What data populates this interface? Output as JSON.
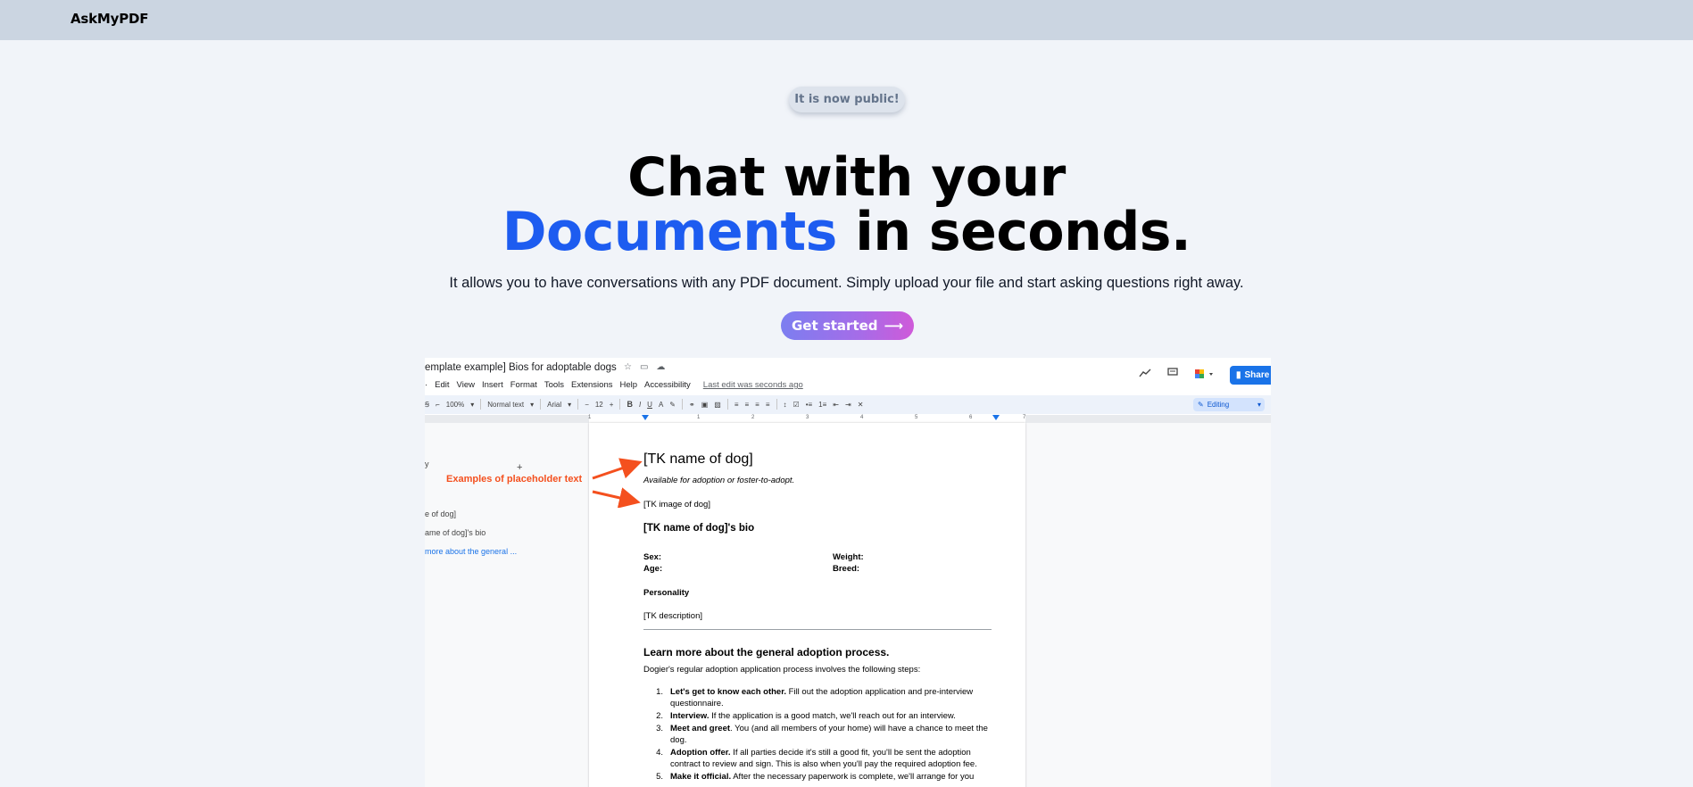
{
  "nav": {
    "brand": "AskMyPDF"
  },
  "badge": "It is now public!",
  "hero": {
    "line1": "Chat with your",
    "line2_highlight": "Documents",
    "line2_rest": " in seconds.",
    "subtitle": "It allows you to have conversations with any PDF document. Simply upload your file and start asking questions right away.",
    "cta_label": "Get started",
    "cta_arrow": "⟶"
  },
  "colors": {
    "accent_blue": "#1d5cf0",
    "cta_gradient_start": "#7c7ef0",
    "cta_gradient_end": "#cf5ad9",
    "annotation": "#f4501e"
  },
  "preview": {
    "doc_title": "emplate example] Bios for adoptable dogs",
    "menu": [
      "Edit",
      "View",
      "Insert",
      "Format",
      "Tools",
      "Extensions",
      "Help",
      "Accessibility"
    ],
    "menu_prefix": "·",
    "last_edit": "Last edit was seconds ago",
    "share_label": "Share",
    "toolbar": {
      "zoom": "100%",
      "style": "Normal text",
      "font": "Arial",
      "font_size": "12",
      "bold": "B",
      "italic": "I",
      "underline": "U",
      "text_color": "A"
    },
    "editing_label": "Editing",
    "ruler_numbers": [
      "1",
      "1",
      "2",
      "3",
      "4",
      "5",
      "6",
      "7"
    ],
    "annotation": "Examples of placeholder text",
    "outline": {
      "heading_frag": "y",
      "plus": "+",
      "items": [
        "e of dog]",
        "ame of dog]'s bio",
        "more about the general ..."
      ]
    },
    "page": {
      "h1": "[TK name of dog]",
      "italic": "Available for adoption or foster-to-adopt.",
      "image": "[TK image of dog]",
      "bio_heading": "[TK name of dog]'s bio",
      "sex": "Sex:",
      "weight": "Weight:",
      "age": "Age:",
      "breed": "Breed:",
      "personality": "Personality",
      "description": "[TK description]",
      "learn_heading": "Learn more about the general adoption process.",
      "learn_body": "Dogier's regular adoption application process involves the following steps:",
      "steps": [
        {
          "n": "1.",
          "b": "Let's get to know each other.",
          "t": " Fill out the adoption application and pre-interview questionnaire."
        },
        {
          "n": "2.",
          "b": "Interview.",
          "t": " If the application is a good match, we'll reach out for an interview."
        },
        {
          "n": "3.",
          "b": "Meet and greet",
          "t": ". You (and all members of your home) will have a chance to meet the dog."
        },
        {
          "n": "4.",
          "b": "Adoption offer.",
          "t": " If all parties decide it's still a good fit, you'll be sent the adoption contract to review and sign. This is also when you'll pay the required adoption fee."
        },
        {
          "n": "5.",
          "b": "Make it official.",
          "t": " After the necessary paperwork is complete, we'll arrange for you"
        }
      ]
    }
  }
}
